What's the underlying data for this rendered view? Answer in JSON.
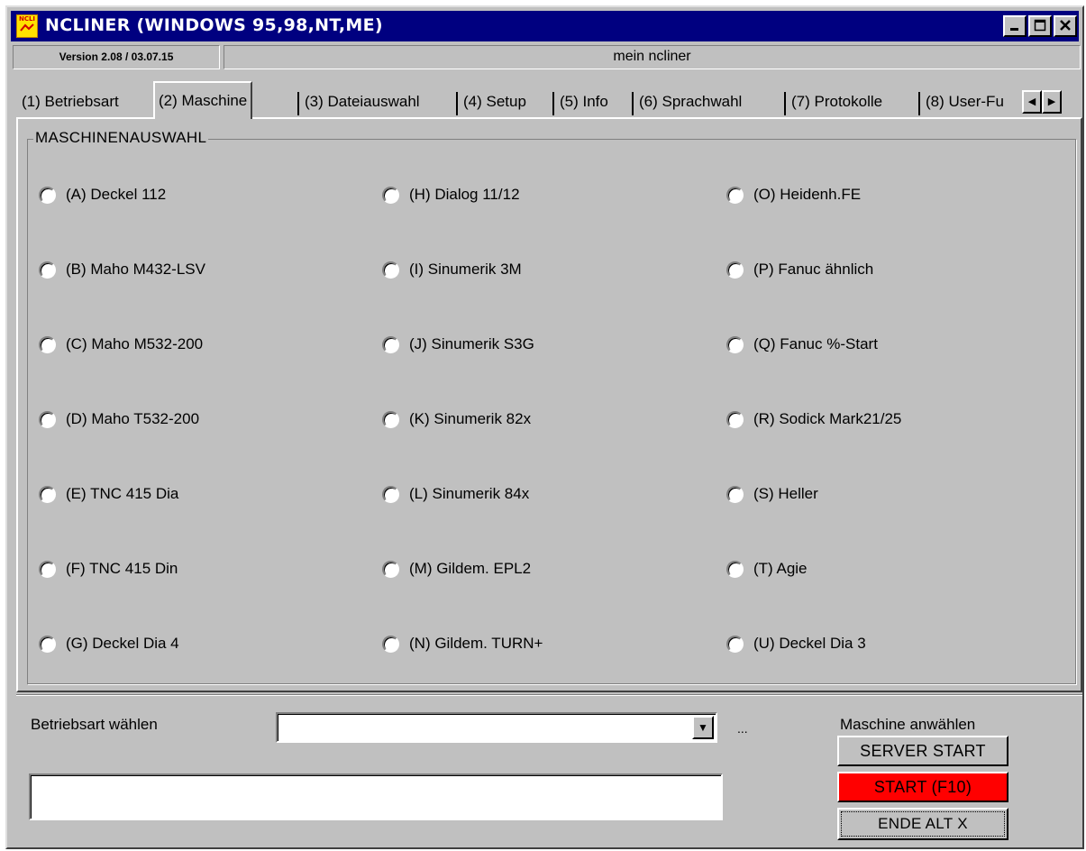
{
  "window": {
    "title": "NCLINER (WINDOWS 95,98,NT,ME)",
    "icon_text": "NCLI"
  },
  "status": {
    "version": "Version 2.08 / 03.07.15",
    "profile": "mein ncliner"
  },
  "tabs": [
    {
      "label": "(1) Betriebsart"
    },
    {
      "label": "(2) Maschine",
      "active": true
    },
    {
      "label": "(3) Dateiauswahl"
    },
    {
      "label": "(4) Setup"
    },
    {
      "label": "(5) Info"
    },
    {
      "label": "(6) Sprachwahl"
    },
    {
      "label": "(7) Protokolle"
    },
    {
      "label": "(8) User-Fu"
    }
  ],
  "group": {
    "title": "MASCHINENAUSWAHL",
    "machines": [
      "(A) Deckel 112",
      "(B) Maho M432-LSV",
      "(C) Maho M532-200",
      "(D) Maho T532-200",
      "(E) TNC 415 Dia",
      "(F) TNC 415 Din",
      "(G) Deckel Dia 4",
      "(H) Dialog 11/12",
      "(I) Sinumerik 3M",
      "(J) Sinumerik S3G",
      "(K) Sinumerik 82x",
      "(L) Sinumerik 84x",
      "(M) Gildem. EPL2",
      "(N) Gildem. TURN+",
      "(O) Heidenh.FE",
      "(P) Fanuc ähnlich",
      "(Q) Fanuc %-Start",
      "(R) Sodick Mark21/25",
      "(S) Heller",
      "(T) Agie",
      "(U) Deckel Dia 3"
    ]
  },
  "bottom": {
    "mode_label": "Betriebsart wählen",
    "mode_value": "",
    "ellipsis": "...",
    "message_value": "",
    "select_label": "Maschine anwählen",
    "server_start": "SERVER START",
    "start": "START (F10)",
    "exit": "ENDE ALT X"
  },
  "colors": {
    "titlebar": "#000080",
    "face": "#c0c0c0",
    "start_button": "#ff0000"
  }
}
